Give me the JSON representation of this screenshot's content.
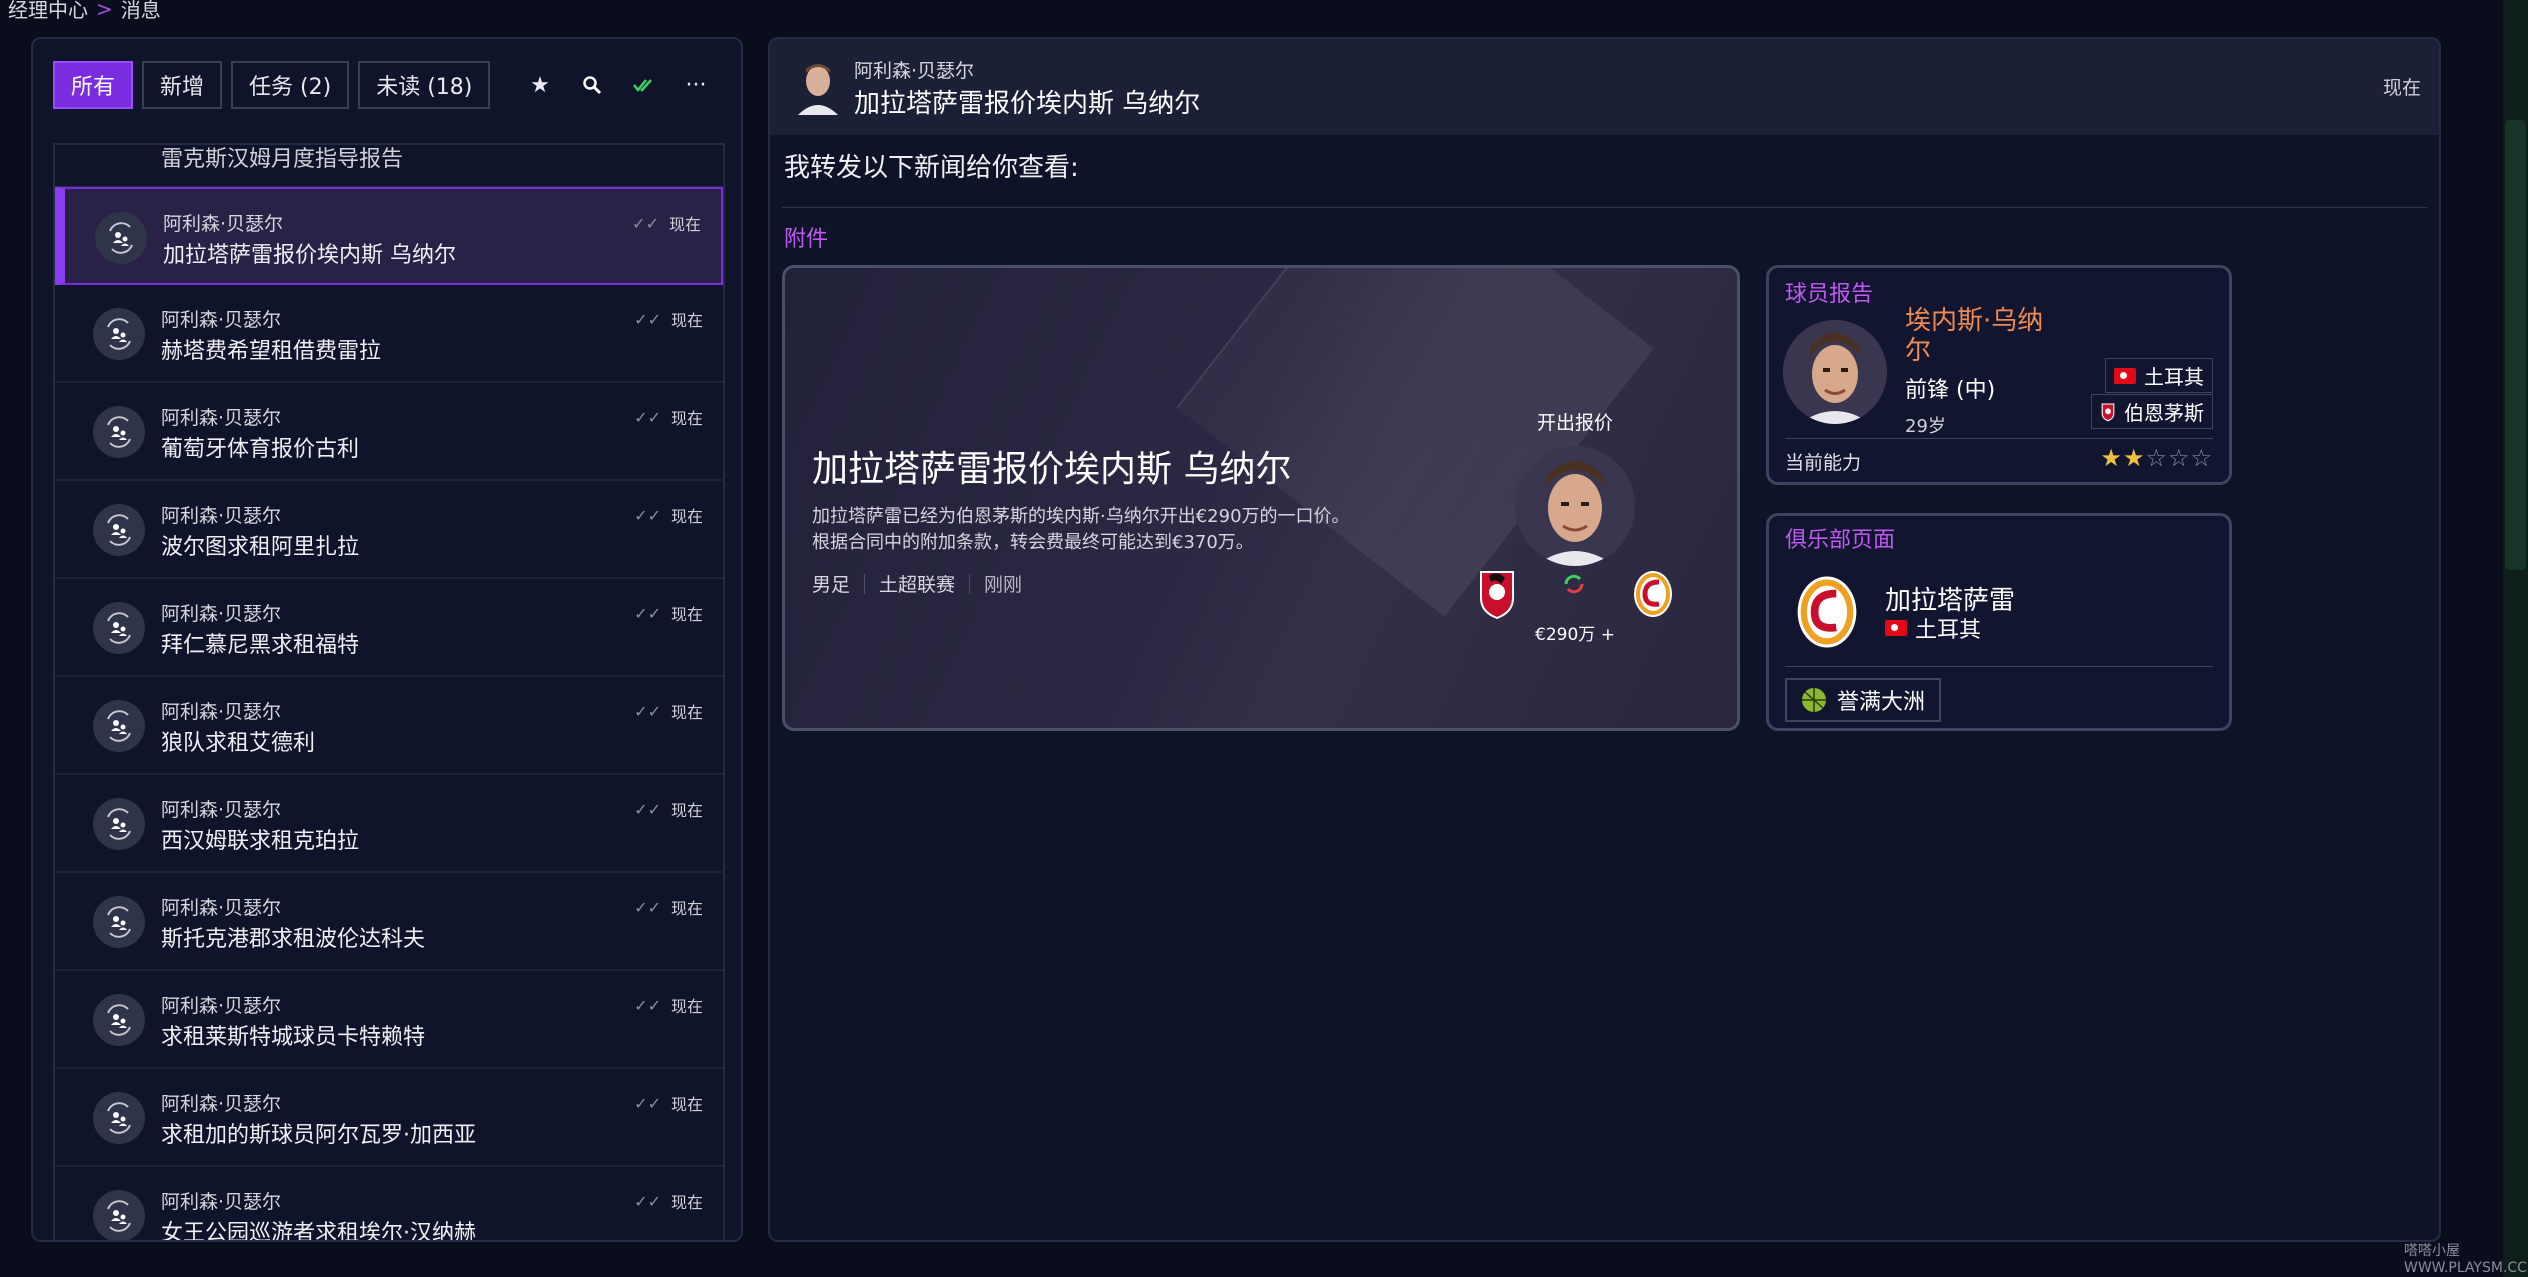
{
  "breadcrumb": {
    "parent": "经理中心",
    "current": "消息"
  },
  "filters": [
    {
      "label": "所有",
      "active": true
    },
    {
      "label": "新增",
      "active": false
    },
    {
      "label": "任务 (2)",
      "active": false
    },
    {
      "label": "未读 (18)",
      "active": false
    }
  ],
  "toolbar_icons": [
    "star-icon",
    "search-icon",
    "double-check-icon",
    "more-icon"
  ],
  "partial_item": {
    "subject": "雷克斯汉姆月度指导报告"
  },
  "messages": [
    {
      "sender": "阿利森·贝瑟尔",
      "subject": "加拉塔萨雷报价埃内斯 乌纳尔",
      "time": "现在",
      "selected": true
    },
    {
      "sender": "阿利森·贝瑟尔",
      "subject": "赫塔费希望租借费雷拉",
      "time": "现在"
    },
    {
      "sender": "阿利森·贝瑟尔",
      "subject": "葡萄牙体育报价古利",
      "time": "现在"
    },
    {
      "sender": "阿利森·贝瑟尔",
      "subject": "波尔图求租阿里扎拉",
      "time": "现在"
    },
    {
      "sender": "阿利森·贝瑟尔",
      "subject": "拜仁慕尼黑求租福特",
      "time": "现在"
    },
    {
      "sender": "阿利森·贝瑟尔",
      "subject": "狼队求租艾德利",
      "time": "现在"
    },
    {
      "sender": "阿利森·贝瑟尔",
      "subject": "西汉姆联求租克珀拉",
      "time": "现在"
    },
    {
      "sender": "阿利森·贝瑟尔",
      "subject": "斯托克港郡求租波伦达科夫",
      "time": "现在"
    },
    {
      "sender": "阿利森·贝瑟尔",
      "subject": "求租莱斯特城球员卡特赖特",
      "time": "现在"
    },
    {
      "sender": "阿利森·贝瑟尔",
      "subject": "求租加的斯球员阿尔瓦罗·加西亚",
      "time": "现在"
    },
    {
      "sender": "阿利森·贝瑟尔",
      "subject": "女王公园巡游者求租埃尔·汉纳赫",
      "time": "现在"
    }
  ],
  "detail": {
    "sender": "阿利森·贝瑟尔",
    "subject": "加拉塔萨雷报价埃内斯 乌纳尔",
    "time": "现在",
    "body": "我转发以下新闻给你查看:",
    "attachments_label": "附件"
  },
  "news_card": {
    "title": "加拉塔萨雷报价埃内斯 乌纳尔",
    "description": "加拉塔萨雷已经为伯恩茅斯的埃内斯·乌纳尔开出€290万的一口价。 根据合同中的附加条款，转会费最终可能达到€370万。",
    "tags": [
      "男足",
      "土超联赛",
      "刚刚"
    ],
    "bid_label": "开出报价",
    "fee": "€290万 +"
  },
  "player_report": {
    "heading": "球员报告",
    "name": "埃内斯·乌纳尔",
    "position": "前锋 (中)",
    "age": "29岁",
    "nationality": "土耳其",
    "club": "伯恩茅斯",
    "ability_label": "当前能力",
    "ability_stars": 2,
    "ability_max": 5
  },
  "club_page": {
    "heading": "俱乐部页面",
    "name": "加拉塔萨雷",
    "country": "土耳其",
    "honor": "誉满大洲"
  },
  "colors": {
    "accent": "#7a2ce0",
    "section_heading": "#c05af0",
    "player_name": "#ef8a52",
    "star": "#f0c040"
  },
  "watermark": "嗒嗒小屋 WWW.PLAYSM.CC"
}
